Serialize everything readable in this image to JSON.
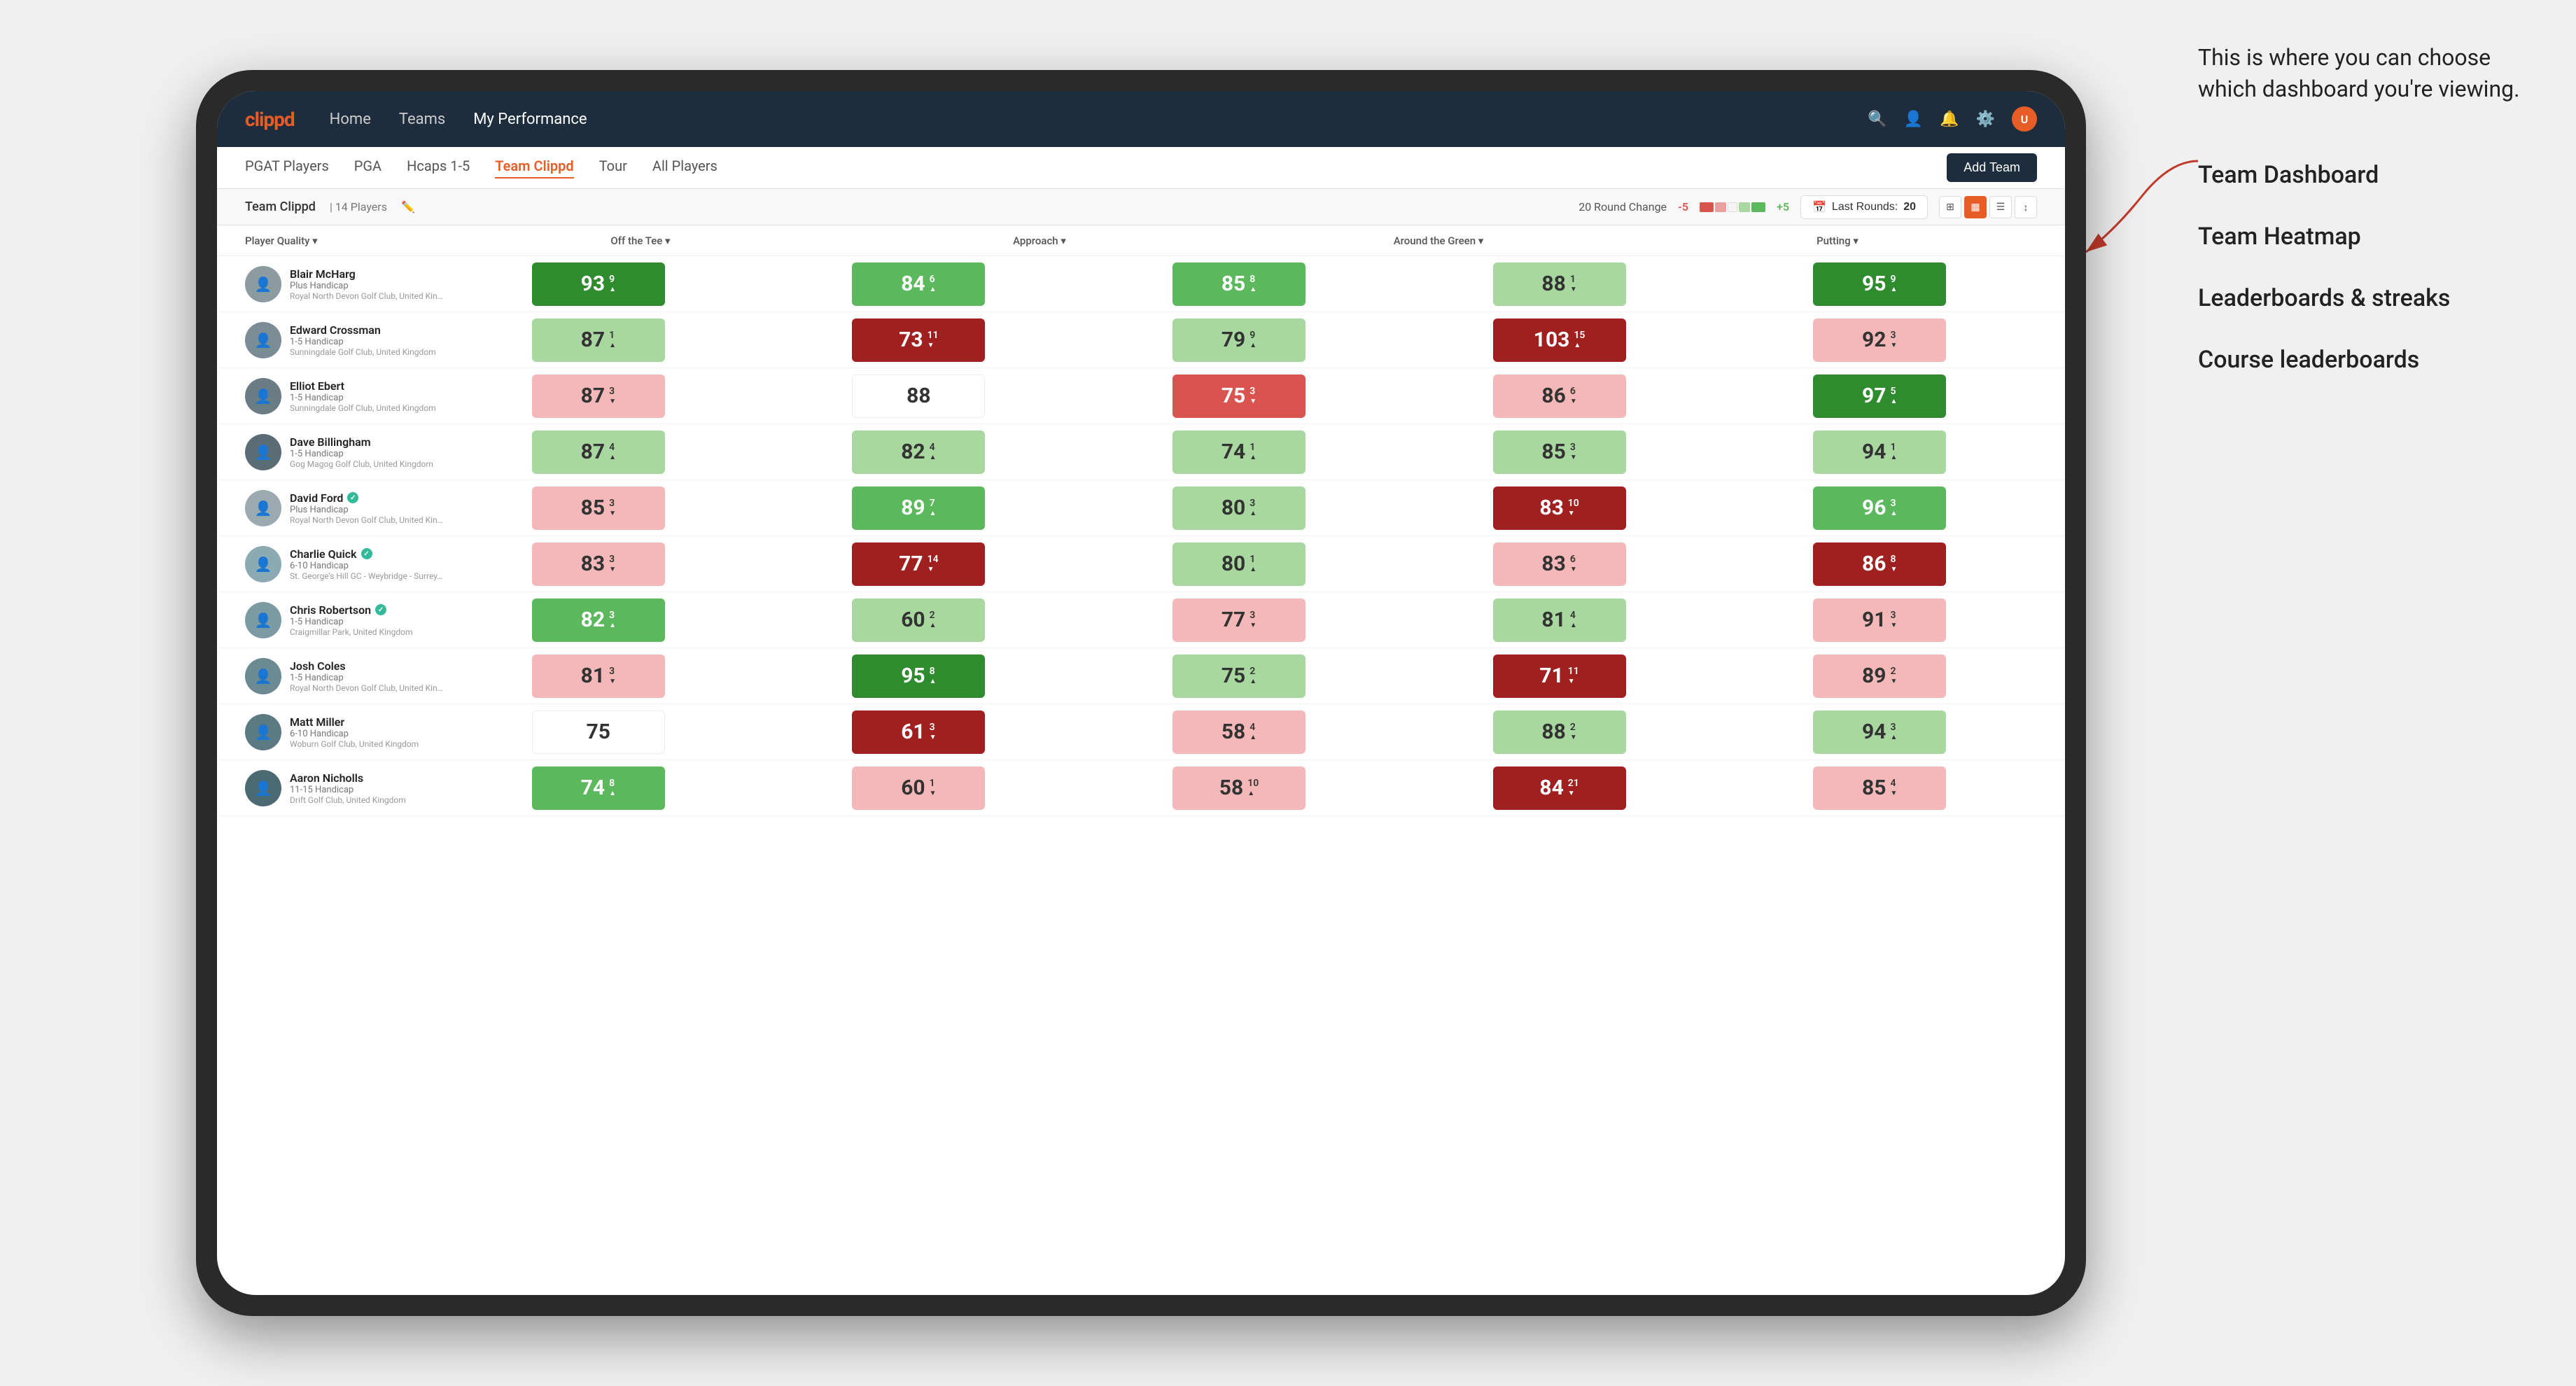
{
  "annotation": {
    "callout": "This is where you can choose which dashboard you're viewing.",
    "items": [
      "Team Dashboard",
      "Team Heatmap",
      "Leaderboards & streaks",
      "Course leaderboards"
    ]
  },
  "nav": {
    "logo": "clippd",
    "links": [
      "Home",
      "Teams",
      "My Performance"
    ],
    "active_link": "My Performance"
  },
  "sub_nav": {
    "links": [
      "PGAT Players",
      "PGA",
      "Hcaps 1-5",
      "Team Clippd",
      "Tour",
      "All Players"
    ],
    "active": "Team Clippd",
    "add_team_label": "Add Team"
  },
  "team_header": {
    "name": "Team Clippd",
    "separator": "|",
    "count": "14 Players",
    "round_change_label": "20 Round Change",
    "neg": "-5",
    "pos": "+5",
    "last_rounds_label": "Last Rounds:",
    "last_rounds_value": "20"
  },
  "columns": {
    "player": "Player Quality ▾",
    "off_tee": "Off the Tee ▾",
    "approach": "Approach ▾",
    "around_green": "Around the Green ▾",
    "putting": "Putting ▾"
  },
  "players": [
    {
      "name": "Blair McHarg",
      "handicap": "Plus Handicap",
      "club": "Royal North Devon Golf Club, United Kingdom",
      "scores": [
        {
          "num": 93,
          "change": "9",
          "dir": "up",
          "bg": "green-strong"
        },
        {
          "num": 84,
          "change": "6",
          "dir": "up",
          "bg": "green-med"
        },
        {
          "num": 85,
          "change": "8",
          "dir": "up",
          "bg": "green-med"
        },
        {
          "num": 88,
          "change": "1",
          "dir": "down",
          "bg": "green-light"
        },
        {
          "num": 95,
          "change": "9",
          "dir": "up",
          "bg": "green-strong"
        }
      ]
    },
    {
      "name": "Edward Crossman",
      "handicap": "1-5 Handicap",
      "club": "Sunningdale Golf Club, United Kingdom",
      "scores": [
        {
          "num": 87,
          "change": "1",
          "dir": "up",
          "bg": "green-light"
        },
        {
          "num": 73,
          "change": "11",
          "dir": "down",
          "bg": "red-strong"
        },
        {
          "num": 79,
          "change": "9",
          "dir": "up",
          "bg": "green-light"
        },
        {
          "num": 103,
          "change": "15",
          "dir": "up",
          "bg": "red-strong"
        },
        {
          "num": 92,
          "change": "3",
          "dir": "down",
          "bg": "red-light"
        }
      ]
    },
    {
      "name": "Elliot Ebert",
      "handicap": "1-5 Handicap",
      "club": "Sunningdale Golf Club, United Kingdom",
      "scores": [
        {
          "num": 87,
          "change": "3",
          "dir": "down",
          "bg": "red-light"
        },
        {
          "num": 88,
          "change": "",
          "dir": "",
          "bg": "white"
        },
        {
          "num": 75,
          "change": "3",
          "dir": "down",
          "bg": "red-med"
        },
        {
          "num": 86,
          "change": "6",
          "dir": "down",
          "bg": "red-light"
        },
        {
          "num": 97,
          "change": "5",
          "dir": "up",
          "bg": "green-strong"
        }
      ]
    },
    {
      "name": "Dave Billingham",
      "handicap": "1-5 Handicap",
      "club": "Gog Magog Golf Club, United Kingdom",
      "scores": [
        {
          "num": 87,
          "change": "4",
          "dir": "up",
          "bg": "green-light"
        },
        {
          "num": 82,
          "change": "4",
          "dir": "up",
          "bg": "green-light"
        },
        {
          "num": 74,
          "change": "1",
          "dir": "up",
          "bg": "green-light"
        },
        {
          "num": 85,
          "change": "3",
          "dir": "down",
          "bg": "green-light"
        },
        {
          "num": 94,
          "change": "1",
          "dir": "up",
          "bg": "green-light"
        }
      ]
    },
    {
      "name": "David Ford",
      "handicap": "Plus Handicap",
      "club": "Royal North Devon Golf Club, United Kingdom",
      "verified": true,
      "scores": [
        {
          "num": 85,
          "change": "3",
          "dir": "down",
          "bg": "red-light"
        },
        {
          "num": 89,
          "change": "7",
          "dir": "up",
          "bg": "green-med"
        },
        {
          "num": 80,
          "change": "3",
          "dir": "up",
          "bg": "green-light"
        },
        {
          "num": 83,
          "change": "10",
          "dir": "down",
          "bg": "red-strong"
        },
        {
          "num": 96,
          "change": "3",
          "dir": "up",
          "bg": "green-med"
        }
      ]
    },
    {
      "name": "Charlie Quick",
      "handicap": "6-10 Handicap",
      "club": "St. George's Hill GC - Weybridge - Surrey, Uni...",
      "verified": true,
      "scores": [
        {
          "num": 83,
          "change": "3",
          "dir": "down",
          "bg": "red-light"
        },
        {
          "num": 77,
          "change": "14",
          "dir": "down",
          "bg": "red-strong"
        },
        {
          "num": 80,
          "change": "1",
          "dir": "up",
          "bg": "green-light"
        },
        {
          "num": 83,
          "change": "6",
          "dir": "down",
          "bg": "red-light"
        },
        {
          "num": 86,
          "change": "8",
          "dir": "down",
          "bg": "red-strong"
        }
      ]
    },
    {
      "name": "Chris Robertson",
      "handicap": "1-5 Handicap",
      "club": "Craigmillar Park, United Kingdom",
      "verified": true,
      "scores": [
        {
          "num": 82,
          "change": "3",
          "dir": "up",
          "bg": "green-med"
        },
        {
          "num": 60,
          "change": "2",
          "dir": "up",
          "bg": "green-light"
        },
        {
          "num": 77,
          "change": "3",
          "dir": "down",
          "bg": "red-light"
        },
        {
          "num": 81,
          "change": "4",
          "dir": "up",
          "bg": "green-light"
        },
        {
          "num": 91,
          "change": "3",
          "dir": "down",
          "bg": "red-light"
        }
      ]
    },
    {
      "name": "Josh Coles",
      "handicap": "1-5 Handicap",
      "club": "Royal North Devon Golf Club, United Kingdom",
      "scores": [
        {
          "num": 81,
          "change": "3",
          "dir": "down",
          "bg": "red-light"
        },
        {
          "num": 95,
          "change": "8",
          "dir": "up",
          "bg": "green-strong"
        },
        {
          "num": 75,
          "change": "2",
          "dir": "up",
          "bg": "green-light"
        },
        {
          "num": 71,
          "change": "11",
          "dir": "down",
          "bg": "red-strong"
        },
        {
          "num": 89,
          "change": "2",
          "dir": "down",
          "bg": "red-light"
        }
      ]
    },
    {
      "name": "Matt Miller",
      "handicap": "6-10 Handicap",
      "club": "Woburn Golf Club, United Kingdom",
      "scores": [
        {
          "num": 75,
          "change": "",
          "dir": "",
          "bg": "white"
        },
        {
          "num": 61,
          "change": "3",
          "dir": "down",
          "bg": "red-strong"
        },
        {
          "num": 58,
          "change": "4",
          "dir": "up",
          "bg": "red-light"
        },
        {
          "num": 88,
          "change": "2",
          "dir": "down",
          "bg": "green-light"
        },
        {
          "num": 94,
          "change": "3",
          "dir": "up",
          "bg": "green-light"
        }
      ]
    },
    {
      "name": "Aaron Nicholls",
      "handicap": "11-15 Handicap",
      "club": "Drift Golf Club, United Kingdom",
      "scores": [
        {
          "num": 74,
          "change": "8",
          "dir": "up",
          "bg": "green-med"
        },
        {
          "num": 60,
          "change": "1",
          "dir": "down",
          "bg": "red-light"
        },
        {
          "num": 58,
          "change": "10",
          "dir": "up",
          "bg": "red-light"
        },
        {
          "num": 84,
          "change": "21",
          "dir": "down",
          "bg": "red-strong"
        },
        {
          "num": 85,
          "change": "4",
          "dir": "down",
          "bg": "red-light"
        }
      ]
    }
  ]
}
